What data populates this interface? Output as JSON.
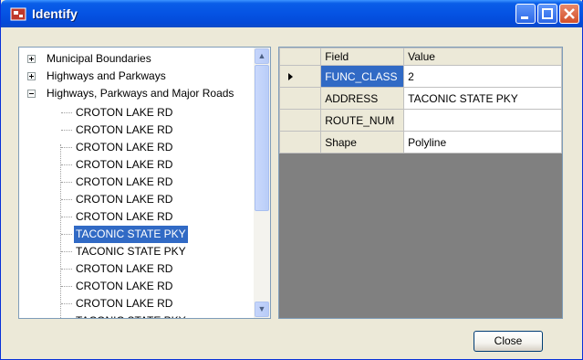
{
  "window": {
    "title": "Identify"
  },
  "tree": {
    "layers": [
      {
        "label": "Municipal Boundaries",
        "expanded": false
      },
      {
        "label": "Highways and Parkways",
        "expanded": false
      },
      {
        "label": "Highways, Parkways and Major Roads",
        "expanded": true
      }
    ],
    "features": [
      "CROTON LAKE RD",
      "CROTON LAKE RD",
      "CROTON LAKE RD",
      "CROTON LAKE RD",
      "CROTON LAKE RD",
      "CROTON LAKE RD",
      "CROTON LAKE RD",
      "TACONIC STATE PKY",
      "TACONIC STATE PKY",
      "CROTON LAKE RD",
      "CROTON LAKE RD",
      "CROTON LAKE RD",
      "TACONIC STATE PKY"
    ],
    "selected_feature_index": 7
  },
  "grid": {
    "headers": {
      "field": "Field",
      "value": "Value"
    },
    "rows": [
      {
        "field": "FUNC_CLASS",
        "value": "2"
      },
      {
        "field": "ADDRESS",
        "value": "TACONIC STATE PKY"
      },
      {
        "field": "ROUTE_NUM",
        "value": ""
      },
      {
        "field": "Shape",
        "value": "Polyline"
      }
    ]
  },
  "buttons": {
    "close": "Close"
  },
  "colors": {
    "titlebar": "#0553e3",
    "selection": "#316ac5",
    "grid_background": "#808080"
  }
}
